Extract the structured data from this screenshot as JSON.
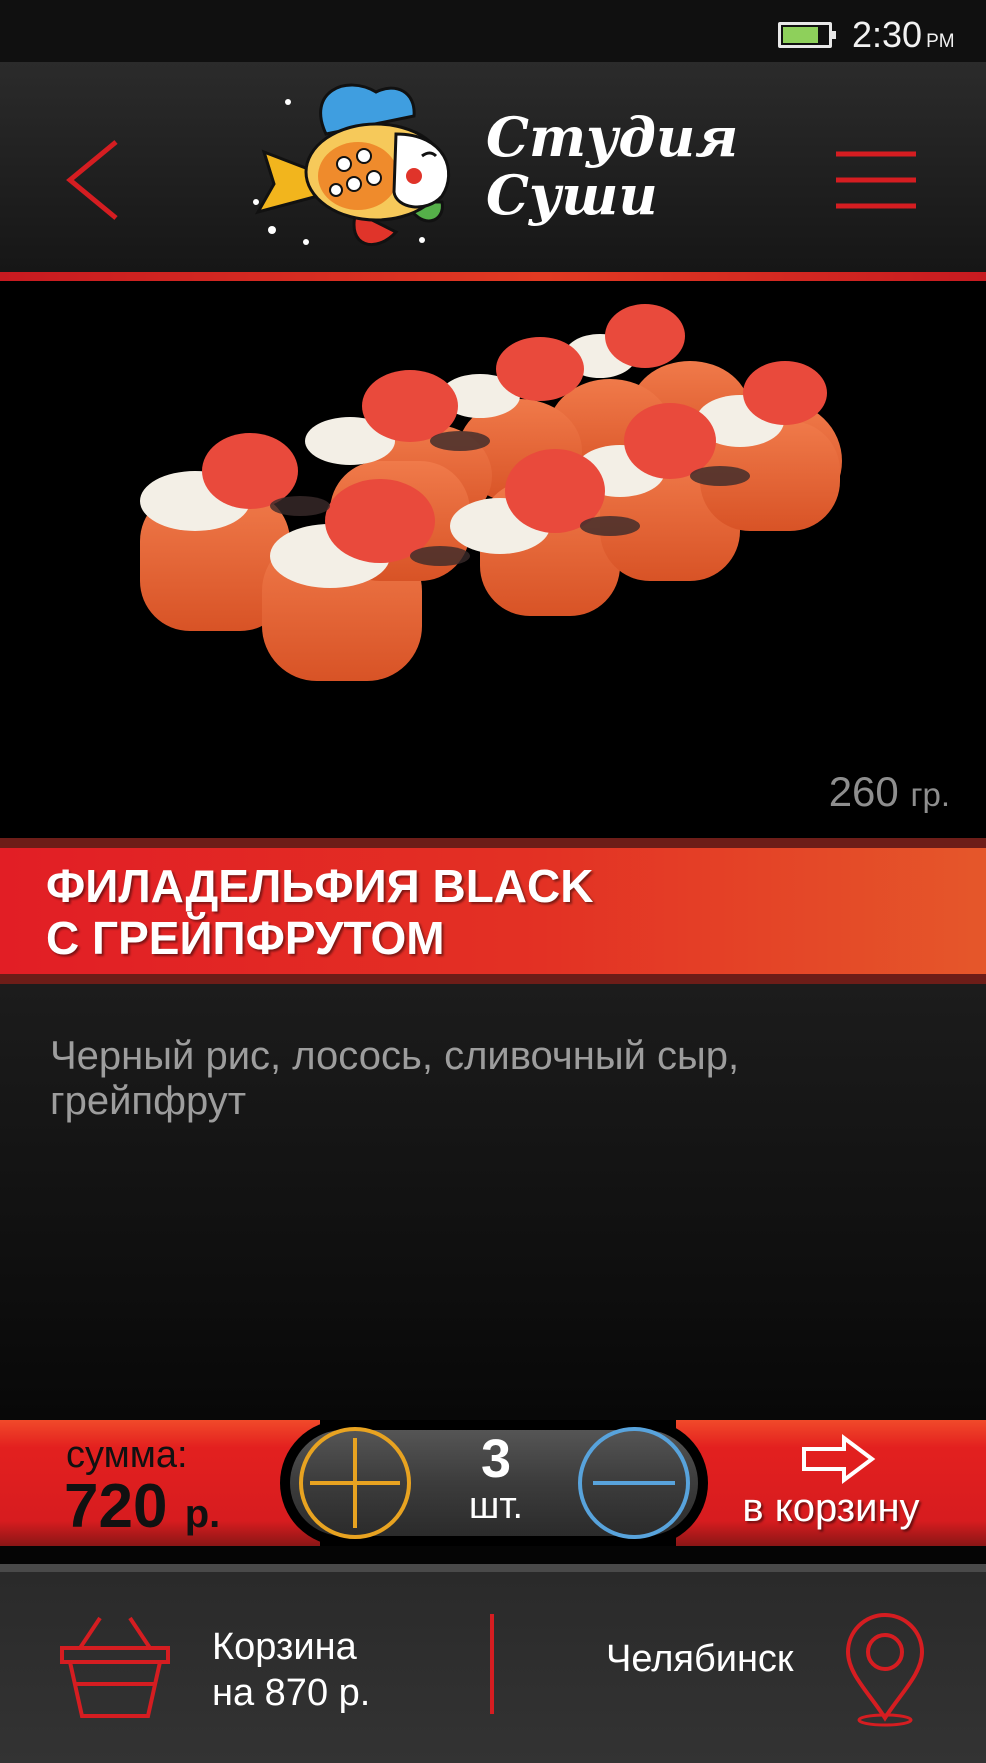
{
  "status_bar": {
    "time": "2:30",
    "ampm": "PM",
    "battery_level": 0.8
  },
  "header": {
    "logo_line1": "Студия",
    "logo_line2": "Суши"
  },
  "product": {
    "weight_value": "260",
    "weight_unit": "гр.",
    "title_line1": "ФИЛАДЕЛЬФИЯ BLACK",
    "title_line2": "С ГРЕЙПФРУТОМ",
    "description": "Черный рис, лосось, сливочный сыр, грейпфрут"
  },
  "order": {
    "sum_label": "сумма:",
    "sum_value": "720",
    "sum_currency": "р.",
    "quantity": "3",
    "quantity_unit": "шт.",
    "add_to_cart_label": "в корзину"
  },
  "bottom_nav": {
    "cart_line1": "Корзина",
    "cart_line2": "на 870 р.",
    "city": "Челябинск"
  },
  "colors": {
    "accent_red": "#e21e25",
    "accent_orange": "#e5572a",
    "plus_color": "#e8a321",
    "minus_color": "#58a3dc"
  },
  "icons": [
    "back-arrow-icon",
    "hamburger-menu-icon",
    "fish-logo-icon",
    "plus-icon",
    "minus-icon",
    "right-arrow-icon",
    "basket-icon",
    "location-pin-icon",
    "battery-icon"
  ]
}
